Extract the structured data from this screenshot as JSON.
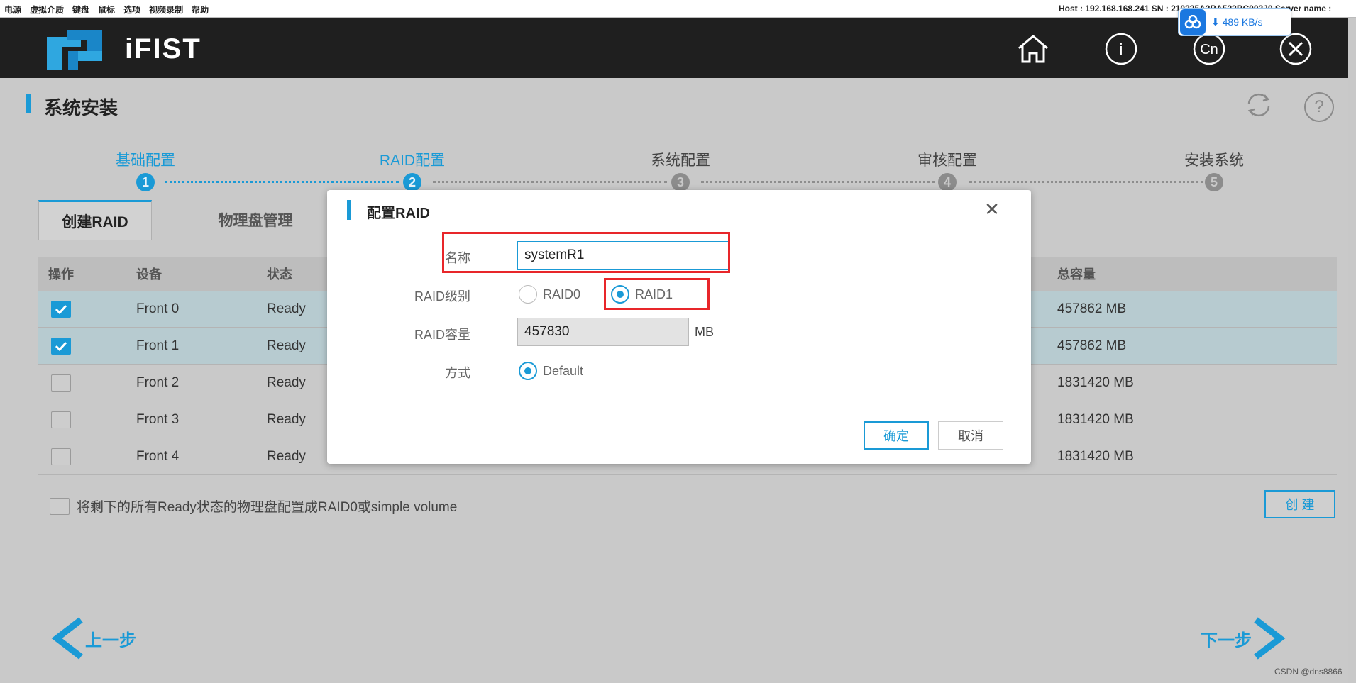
{
  "kvm": {
    "menu": [
      "电源",
      "虚拟介质",
      "键盘",
      "鼠标",
      "选项",
      "视频录制",
      "帮助"
    ],
    "info": "Host : 192.168.168.241   SN : 210235A3BA523BC003J0   Server name :"
  },
  "download": {
    "speed": "489 KB/s"
  },
  "app": {
    "brand": "iFIST",
    "lang_label": "Cn",
    "info_label": "i"
  },
  "page": {
    "title": "系统安装"
  },
  "steps": [
    {
      "label": "基础配置",
      "num": "1",
      "active": true
    },
    {
      "label": "RAID配置",
      "num": "2",
      "active": true
    },
    {
      "label": "系统配置",
      "num": "3",
      "active": false
    },
    {
      "label": "审核配置",
      "num": "4",
      "active": false
    },
    {
      "label": "安装系统",
      "num": "5",
      "active": false
    }
  ],
  "tabs": {
    "create": "创建RAID",
    "physical": "物理盘管理"
  },
  "table": {
    "headers": {
      "op": "操作",
      "device": "设备",
      "status": "状态",
      "capacity": "总容量"
    },
    "rows": [
      {
        "device": "Front 0",
        "status": "Ready",
        "capacity": "457862 MB",
        "checked": true
      },
      {
        "device": "Front 1",
        "status": "Ready",
        "capacity": "457862 MB",
        "checked": true
      },
      {
        "device": "Front 2",
        "status": "Ready",
        "capacity": "1831420 MB",
        "checked": false
      },
      {
        "device": "Front 3",
        "status": "Ready",
        "capacity": "1831420 MB",
        "checked": false
      },
      {
        "device": "Front 4",
        "status": "Ready",
        "capacity": "1831420 MB",
        "checked": false
      }
    ]
  },
  "bottom_option": "将剩下的所有Ready状态的物理盘配置成RAID0或simple volume",
  "create_button": "创 建",
  "nav": {
    "prev": "上一步",
    "next": "下一步"
  },
  "watermark": "CSDN @dns8866",
  "modal": {
    "title": "配置RAID",
    "name_label": "名称",
    "name_value": "systemR1",
    "level_label": "RAID级别",
    "level_options": [
      "RAID0",
      "RAID1"
    ],
    "level_selected": "RAID1",
    "capacity_label": "RAID容量",
    "capacity_value": "457830",
    "capacity_unit": "MB",
    "mode_label": "方式",
    "mode_option": "Default",
    "ok": "确定",
    "cancel": "取消"
  },
  "colors": {
    "accent": "#1a9ad6",
    "highlight": "#e8262a",
    "header_bg": "#1f1f1f"
  }
}
